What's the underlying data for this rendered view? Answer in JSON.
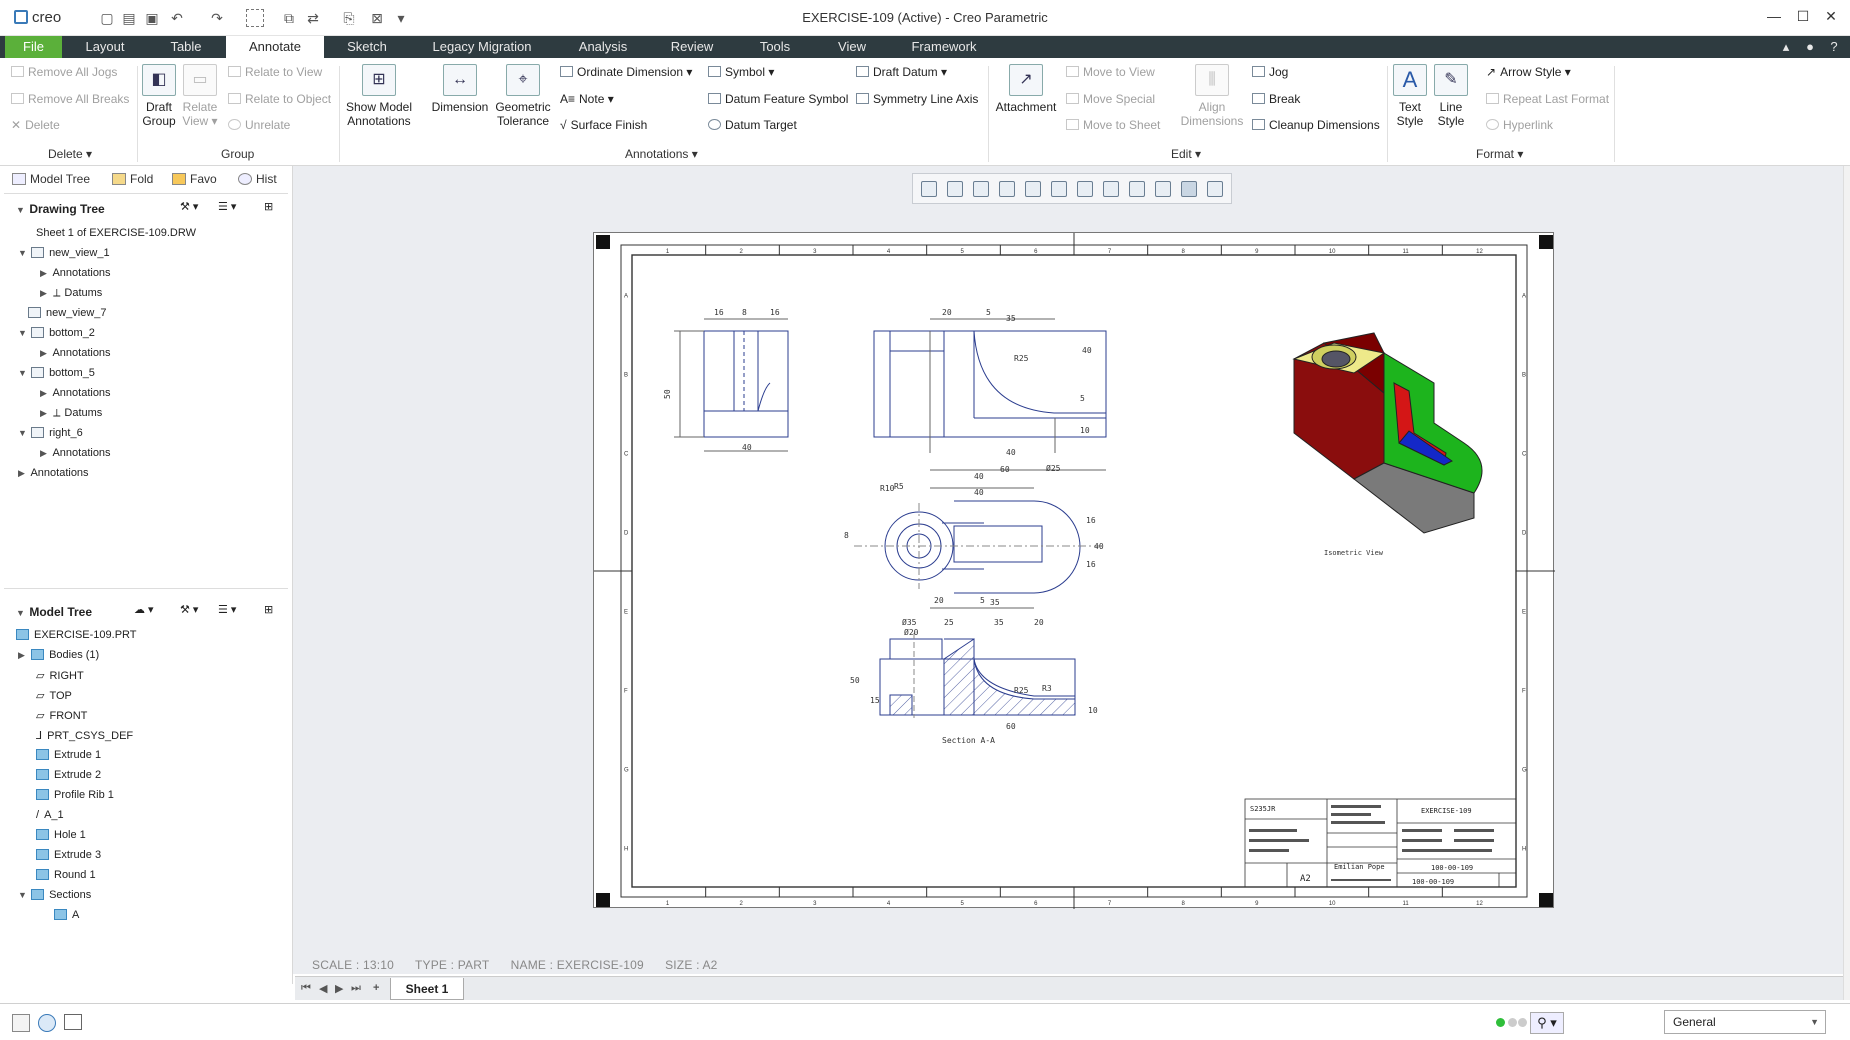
{
  "app": {
    "logo": "creo",
    "window_title": "EXERCISE-109 (Active) - Creo Parametric"
  },
  "menu": {
    "tabs": [
      "File",
      "Layout",
      "Table",
      "Annotate",
      "Sketch",
      "Legacy Migration",
      "Analysis",
      "Review",
      "Tools",
      "View",
      "Framework"
    ],
    "active": "Annotate"
  },
  "ribbon": {
    "delete_group": {
      "remove_all_jogs": "Remove All Jogs",
      "remove_all_breaks": "Remove All Breaks",
      "delete": "Delete",
      "label": "Delete"
    },
    "group_group": {
      "draft_group": "Draft Group",
      "relate_view": "Relate View",
      "relate_to_view": "Relate to View",
      "relate_to_object": "Relate to Object",
      "unrelate": "Unrelate",
      "label": "Group"
    },
    "annotations_group": {
      "show_model_annotations": "Show Model Annotations",
      "dimension": "Dimension",
      "geometric_tolerance": "Geometric Tolerance",
      "ordinate_dimension": "Ordinate Dimension",
      "note": "Note",
      "surface_finish": "Surface Finish",
      "symbol": "Symbol",
      "datum_feature_symbol": "Datum Feature Symbol",
      "datum_target": "Datum Target",
      "draft_datum": "Draft Datum",
      "symmetry_line_axis": "Symmetry Line Axis",
      "label": "Annotations"
    },
    "edit_group": {
      "attachment": "Attachment",
      "move_to_view": "Move to View",
      "move_special": "Move Special",
      "move_to_sheet": "Move to Sheet",
      "align_dimensions": "Align Dimensions",
      "jog": "Jog",
      "break": "Break",
      "cleanup_dimensions": "Cleanup Dimensions",
      "label": "Edit"
    },
    "format_group": {
      "text_style": "Text Style",
      "line_style": "Line Style",
      "arrow_style": "Arrow Style",
      "repeat_last_format": "Repeat Last Format",
      "hyperlink": "Hyperlink",
      "label": "Format"
    }
  },
  "left_tabs": [
    "Model Tree",
    "Fold",
    "Favo",
    "Hist"
  ],
  "drawing_tree": {
    "title": "Drawing Tree",
    "items": [
      {
        "label": "Sheet 1 of EXERCISE-109.DRW"
      },
      {
        "label": "new_view_1"
      },
      {
        "label": "Annotations"
      },
      {
        "label": "Datums"
      },
      {
        "label": "new_view_7"
      },
      {
        "label": "bottom_2"
      },
      {
        "label": "Annotations"
      },
      {
        "label": "bottom_5"
      },
      {
        "label": "Annotations"
      },
      {
        "label": "Datums"
      },
      {
        "label": "right_6"
      },
      {
        "label": "Annotations"
      },
      {
        "label": "Annotations"
      }
    ]
  },
  "model_tree": {
    "title": "Model Tree",
    "items": [
      {
        "label": "EXERCISE-109.PRT"
      },
      {
        "label": "Bodies (1)"
      },
      {
        "label": "RIGHT"
      },
      {
        "label": "TOP"
      },
      {
        "label": "FRONT"
      },
      {
        "label": "PRT_CSYS_DEF"
      },
      {
        "label": "Extrude 1"
      },
      {
        "label": "Extrude 2"
      },
      {
        "label": "Profile Rib 1"
      },
      {
        "label": "A_1"
      },
      {
        "label": "Hole 1"
      },
      {
        "label": "Extrude 3"
      },
      {
        "label": "Round 1"
      },
      {
        "label": "Sections"
      },
      {
        "label": "A"
      }
    ]
  },
  "drawing": {
    "isometric_label": "Isometric View",
    "section_label": "Section A-A",
    "title_block": {
      "part": "EXERCISE-109",
      "size": "A2",
      "material": "S235JR",
      "number1": "100-00-109",
      "number2": "100-00-109",
      "author": "Emilian Pope"
    },
    "border_cols": [
      "1",
      "2",
      "3",
      "4",
      "5",
      "6",
      "7",
      "8",
      "9",
      "10",
      "11",
      "12"
    ],
    "border_rows": [
      "A",
      "B",
      "C",
      "D",
      "E",
      "F",
      "G",
      "H"
    ]
  },
  "status": {
    "scale": "SCALE : 13:10",
    "type": "TYPE : PART",
    "name": "NAME : EXERCISE-109",
    "size": "SIZE : A2"
  },
  "sheet_tab": "Sheet 1",
  "filter_value": "General",
  "colors": {
    "menubar": "#2e3b40",
    "file_tab": "#5bb03a",
    "canvas": "#ebedf1",
    "dim_line": "#2b3d8f"
  }
}
